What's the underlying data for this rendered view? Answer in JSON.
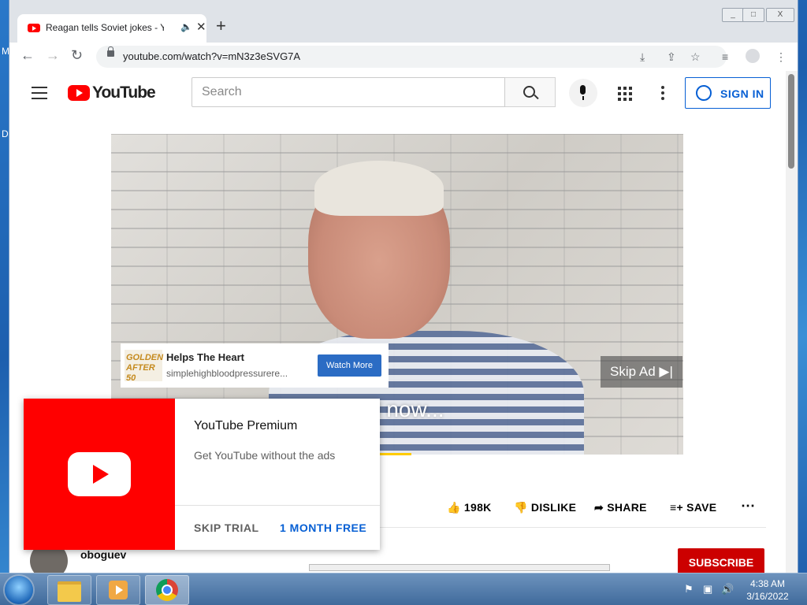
{
  "desktop": {
    "letter_m": "M",
    "letter_d": "D"
  },
  "browser": {
    "tab_title": "Reagan tells Soviet jokes - Yo",
    "new_tab": "+",
    "url": "youtube.com/watch?v=mN3z3eSVG7A",
    "win_min": "_",
    "win_max": "□",
    "win_close": "X"
  },
  "youtube": {
    "logo_text": "YouTube",
    "search_placeholder": "Search",
    "sign_in": "SIGN IN"
  },
  "ad_overlay": {
    "brand": "GOLDEN AFTER 50",
    "headline": "Helps The Heart",
    "url": "simplehighbloodpressurere...",
    "cta": "Watch More"
  },
  "video": {
    "skip_ad": "Skip Ad ▶|",
    "caption": "d now..."
  },
  "actions": {
    "likes": "198K",
    "dislike": "DISLIKE",
    "share": "SHARE",
    "save": "SAVE"
  },
  "channel": {
    "name": "oboguev",
    "subscribe": "SUBSCRIBE"
  },
  "premium_promo": {
    "title": "YouTube Premium",
    "subtitle": "Get YouTube without the ads",
    "skip": "SKIP TRIAL",
    "free": "1 MONTH FREE"
  },
  "taskbar": {
    "time": "4:38 AM",
    "date": "3/16/2022"
  },
  "colors": {
    "brand_red": "#ff0000",
    "link_blue": "#065fd4"
  }
}
